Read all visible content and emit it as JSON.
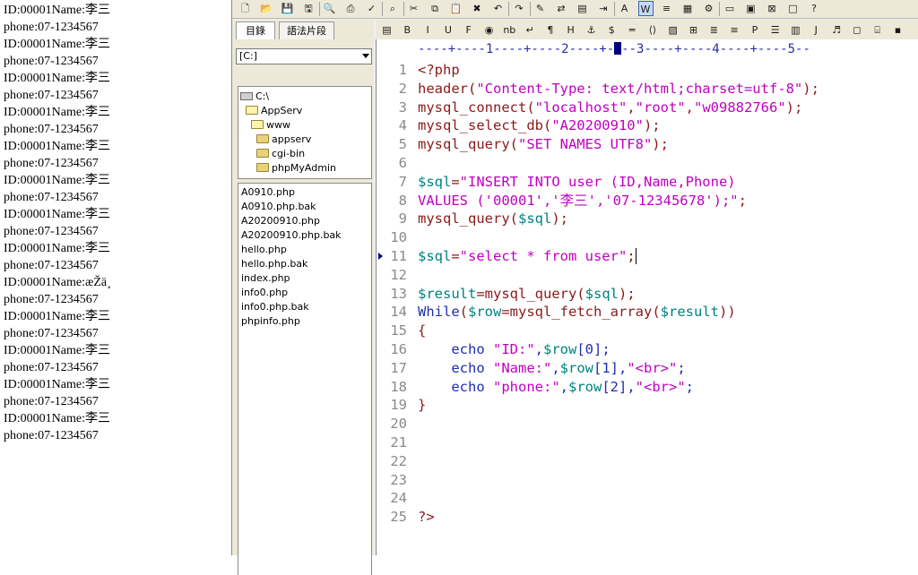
{
  "browser_output": {
    "lines": [
      "ID:00001Name:李三",
      "phone:07-1234567",
      "ID:00001Name:李三",
      "phone:07-1234567",
      "ID:00001Name:李三",
      "phone:07-1234567",
      "ID:00001Name:李三",
      "phone:07-1234567",
      "ID:00001Name:李三",
      "phone:07-1234567",
      "ID:00001Name:李三",
      "phone:07-1234567",
      "ID:00001Name:李三",
      "phone:07-1234567",
      "ID:00001Name:李三",
      "phone:07-1234567",
      "ID:00001Name:æŽä¸",
      "phone:07-1234567",
      "ID:00001Name:李三",
      "phone:07-1234567",
      "ID:00001Name:李三",
      "phone:07-1234567",
      "ID:00001Name:李三",
      "phone:07-1234567",
      "ID:00001Name:李三",
      "phone:07-1234567"
    ]
  },
  "sidebar": {
    "tabs": [
      {
        "label": "目錄",
        "active": true
      },
      {
        "label": "語法片段",
        "active": false
      }
    ],
    "drive": "[C:]",
    "tree": [
      {
        "label": "C:\\",
        "icon": "drive-icon"
      },
      {
        "label": "AppServ",
        "icon": "open-folder-icon"
      },
      {
        "label": "www",
        "icon": "open-folder-icon"
      },
      {
        "label": "appserv",
        "icon": "folder-icon"
      },
      {
        "label": "cgi-bin",
        "icon": "folder-icon"
      },
      {
        "label": "phpMyAdmin",
        "icon": "folder-icon"
      }
    ],
    "files": [
      "A0910.php",
      "A0910.php.bak",
      "A20200910.php",
      "A20200910.php.bak",
      "hello.php",
      "hello.php.bak",
      "index.php",
      "info0.php",
      "info0.php.bak",
      "phpinfo.php"
    ]
  },
  "ruler": "----+----1----+----2----+-",
  "ruler_tail": "--3----+----4----+----5--",
  "editor": {
    "current_line": 11,
    "lines": [
      {
        "n": "1",
        "tokens": [
          [
            "t-kw",
            "<?php"
          ]
        ]
      },
      {
        "n": "2",
        "tokens": [
          [
            "t-func",
            "header("
          ],
          [
            "t-str",
            "\"Content-Type: text/html;charset=utf-8\""
          ],
          [
            "t-func",
            ");"
          ]
        ]
      },
      {
        "n": "3",
        "tokens": [
          [
            "t-func",
            "mysql_connect("
          ],
          [
            "t-str",
            "\"localhost\""
          ],
          [
            "t-func",
            ","
          ],
          [
            "t-str",
            "\"root\""
          ],
          [
            "t-func",
            ","
          ],
          [
            "t-str",
            "\"w09882766\""
          ],
          [
            "t-func",
            ");"
          ]
        ]
      },
      {
        "n": "4",
        "tokens": [
          [
            "t-func",
            "mysql_select_db("
          ],
          [
            "t-str",
            "\"A20200910\""
          ],
          [
            "t-func",
            ");"
          ]
        ]
      },
      {
        "n": "5",
        "tokens": [
          [
            "t-func",
            "mysql_query("
          ],
          [
            "t-str",
            "\"SET NAMES UTF8\""
          ],
          [
            "t-func",
            ");"
          ]
        ]
      },
      {
        "n": "6",
        "tokens": []
      },
      {
        "n": "7",
        "tokens": [
          [
            "t-var",
            "$sql"
          ],
          [
            "t-func",
            "="
          ],
          [
            "t-str",
            "\"INSERT INTO user (ID,Name,Phone)"
          ]
        ]
      },
      {
        "n": "8",
        "tokens": [
          [
            "t-str",
            "VALUES ('00001','李三','07-12345678');\""
          ],
          [
            "t-func",
            ";"
          ]
        ]
      },
      {
        "n": "9",
        "tokens": [
          [
            "t-func",
            "mysql_query("
          ],
          [
            "t-var",
            "$sql"
          ],
          [
            "t-func",
            ");"
          ]
        ]
      },
      {
        "n": "10",
        "tokens": []
      },
      {
        "n": "11",
        "tokens": [
          [
            "t-var",
            "$sql"
          ],
          [
            "t-func",
            "="
          ],
          [
            "t-str",
            "\"select * from user\""
          ],
          [
            "t-func",
            ";"
          ]
        ]
      },
      {
        "n": "12",
        "tokens": []
      },
      {
        "n": "13",
        "tokens": [
          [
            "t-var",
            "$result"
          ],
          [
            "t-func",
            "=mysql_query("
          ],
          [
            "t-var",
            "$sql"
          ],
          [
            "t-func",
            ");"
          ]
        ]
      },
      {
        "n": "14",
        "tokens": [
          [
            "t-blue",
            "While"
          ],
          [
            "t-func",
            "("
          ],
          [
            "t-var",
            "$row"
          ],
          [
            "t-func",
            "=mysql_fetch_array("
          ],
          [
            "t-var",
            "$result"
          ],
          [
            "t-func",
            "))"
          ]
        ]
      },
      {
        "n": "15",
        "tokens": [
          [
            "t-func",
            "{"
          ]
        ]
      },
      {
        "n": "16",
        "tokens": [
          [
            "t-plain",
            "    "
          ],
          [
            "t-blue",
            "echo "
          ],
          [
            "t-str",
            "\"ID:\""
          ],
          [
            "t-blue",
            ","
          ],
          [
            "t-var",
            "$row"
          ],
          [
            "t-blue",
            "[0];"
          ]
        ]
      },
      {
        "n": "17",
        "tokens": [
          [
            "t-plain",
            "    "
          ],
          [
            "t-blue",
            "echo "
          ],
          [
            "t-str",
            "\"Name:\""
          ],
          [
            "t-blue",
            ","
          ],
          [
            "t-var",
            "$row"
          ],
          [
            "t-blue",
            "[1],"
          ],
          [
            "t-str",
            "\"<br>\""
          ],
          [
            "t-blue",
            ";"
          ]
        ]
      },
      {
        "n": "18",
        "tokens": [
          [
            "t-plain",
            "    "
          ],
          [
            "t-blue",
            "echo "
          ],
          [
            "t-str",
            "\"phone:\""
          ],
          [
            "t-blue",
            ","
          ],
          [
            "t-var",
            "$row"
          ],
          [
            "t-blue",
            "[2],"
          ],
          [
            "t-str",
            "\"<br>\""
          ],
          [
            "t-blue",
            ";"
          ]
        ]
      },
      {
        "n": "19",
        "tokens": [
          [
            "t-func",
            "}"
          ]
        ]
      },
      {
        "n": "20",
        "tokens": []
      },
      {
        "n": "21",
        "tokens": []
      },
      {
        "n": "22",
        "tokens": []
      },
      {
        "n": "23",
        "tokens": []
      },
      {
        "n": "24",
        "tokens": []
      },
      {
        "n": "25",
        "tokens": [
          [
            "t-kw",
            "?>"
          ]
        ]
      }
    ]
  },
  "toolbar1_icons": [
    "new-icon",
    "open-icon",
    "save-icon",
    "save-all-icon",
    "print-preview-icon",
    "print-icon",
    "spell-check-icon",
    "find-icon",
    "cut-icon",
    "copy-icon",
    "paste-icon",
    "delete-icon",
    "undo-icon",
    "redo-icon",
    "pen-icon",
    "replace-icon",
    "paste-special-icon",
    "indent-icon",
    "font-icon",
    "word-wrap-icon",
    "line-numbers-icon",
    "ruler-icon",
    "properties-icon",
    "window-icon",
    "tile-icon",
    "close-window-icon",
    "full-screen-icon",
    "help-icon"
  ],
  "toolbar2_icons": [
    "view-icon",
    "bold-icon",
    "italic-icon",
    "underline-icon",
    "font-tag-icon",
    "color-icon",
    "nbsp-icon",
    "enter-icon",
    "paragraph-icon",
    "heading-icon",
    "anchor-icon",
    "symbol-icon",
    "hr-icon",
    "comment-icon",
    "image-icon",
    "table-icon",
    "center-icon",
    "right-align-icon",
    "pre-icon",
    "list-icon",
    "snippet-icon",
    "java-icon",
    "script-icon",
    "tag-icon",
    "frame-icon",
    "extra-icon"
  ]
}
